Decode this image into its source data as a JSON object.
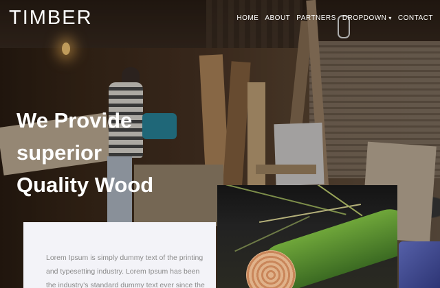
{
  "brand": {
    "logo": "TIMBER"
  },
  "nav": {
    "items": [
      {
        "label": "HOME"
      },
      {
        "label": "ABOUT"
      },
      {
        "label": "PARTNERS"
      },
      {
        "label": "DROPDOWN"
      },
      {
        "label": "CONTACT"
      }
    ],
    "dropdown_caret": "▾"
  },
  "hero": {
    "headline_line1": "We Provide superior",
    "headline_line2": "Quality Wood"
  },
  "about": {
    "text": "Lorem Ipsum is simply dummy text of the printing and typesetting industry. Lorem Ipsum has been the industry's standard dummy text ever since the"
  },
  "colors": {
    "card_bg": "#f3f3f8",
    "text_muted": "#8a8a8a",
    "nav_text": "#ffffff"
  }
}
